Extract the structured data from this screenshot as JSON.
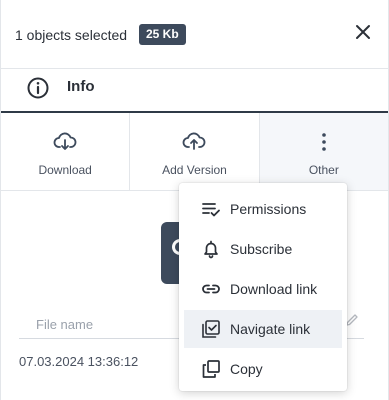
{
  "header": {
    "selection_text": "1 objects selected",
    "size_badge": "25 Kb"
  },
  "tab": {
    "label": "Info"
  },
  "actions": [
    {
      "label": "Download",
      "icon": "cloud-download-icon"
    },
    {
      "label": "Add Version",
      "icon": "cloud-upload-icon"
    },
    {
      "label": "Other",
      "icon": "more-vertical-icon"
    }
  ],
  "details": {
    "file_name_placeholder": "File name",
    "date": "07.03.2024 13:36:12"
  },
  "menu": {
    "items": [
      {
        "label": "Permissions",
        "icon": "permissions-icon"
      },
      {
        "label": "Subscribe",
        "icon": "bell-icon"
      },
      {
        "label": "Download link",
        "icon": "link-icon"
      },
      {
        "label": "Navigate link",
        "icon": "navigate-icon",
        "highlighted": true
      },
      {
        "label": "Copy",
        "icon": "copy-icon"
      }
    ]
  },
  "colors": {
    "badge_bg": "#3d4a5c",
    "accent_dark": "#2f3a47",
    "menu_hover": "#eef1f5"
  }
}
